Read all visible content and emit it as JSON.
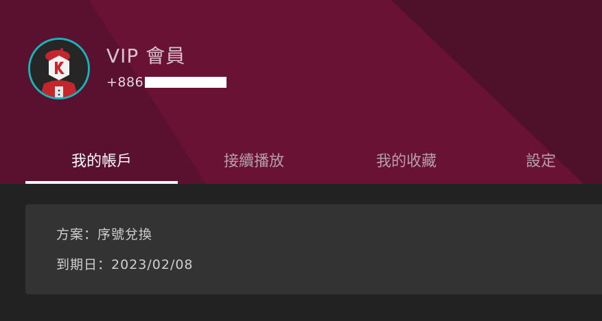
{
  "profile": {
    "avatar_icon": "kkbox-mascot-avatar-icon",
    "membership": "VIP 會員",
    "phone_prefix": "+886"
  },
  "tabs": [
    {
      "label": "我的帳戶",
      "active": true
    },
    {
      "label": "接續播放",
      "active": false
    },
    {
      "label": "我的收藏",
      "active": false
    },
    {
      "label": "設定",
      "active": false
    }
  ],
  "account": {
    "plan_label": "方案：",
    "plan_value": "序號兌換",
    "expiry_label": "到期日：",
    "expiry_value": "2023/02/08"
  },
  "colors": {
    "header_base": "#5e1230",
    "accent_ring": "#18b3bb",
    "page_background": "#222222",
    "card_background": "#333333"
  }
}
